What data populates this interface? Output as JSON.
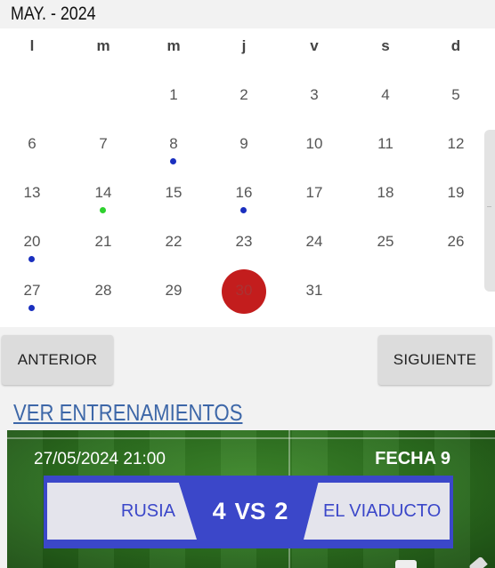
{
  "calendar": {
    "month_label": "MAY. - 2024",
    "weekdays": [
      "l",
      "m",
      "m",
      "j",
      "v",
      "s",
      "d"
    ],
    "weeks": [
      [
        "",
        "",
        "1",
        "2",
        "3",
        "4",
        "5"
      ],
      [
        "6",
        "7",
        "8",
        "9",
        "10",
        "11",
        "12"
      ],
      [
        "13",
        "14",
        "15",
        "16",
        "17",
        "18",
        "19"
      ],
      [
        "20",
        "21",
        "22",
        "23",
        "24",
        "25",
        "26"
      ],
      [
        "27",
        "28",
        "29",
        "30",
        "31",
        "",
        ""
      ]
    ],
    "today": "30",
    "event_dots": [
      {
        "day": "8",
        "color": "#1a2fbf"
      },
      {
        "day": "14",
        "color": "#2ed12e"
      },
      {
        "day": "16",
        "color": "#1a2fbf"
      },
      {
        "day": "20",
        "color": "#1a2fbf"
      },
      {
        "day": "27",
        "color": "#1a2fbf"
      }
    ],
    "today_color": "#c31d1d"
  },
  "buttons": {
    "previous": "ANTERIOR",
    "next": "SIGUIENTE"
  },
  "link": {
    "trainings": "VER ENTRENAMIENTOS"
  },
  "match": {
    "datetime": "27/05/2024 21:00",
    "round": "FECHA 9",
    "home_team": "RUSIA",
    "home_score": "4",
    "vs": "VS",
    "away_score": "2",
    "away_team": "EL VIADUCTO"
  }
}
